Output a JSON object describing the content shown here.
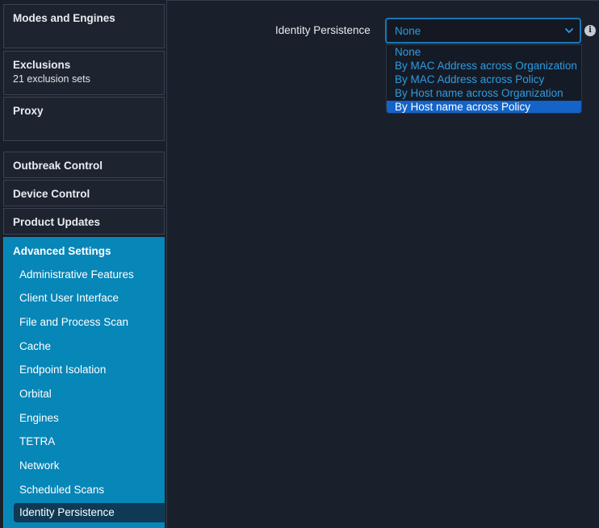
{
  "sidebar": {
    "modes": {
      "title": "Modes and Engines"
    },
    "exclusions": {
      "title": "Exclusions",
      "subtitle": "21 exclusion sets"
    },
    "proxy": {
      "title": "Proxy"
    },
    "outbreak": {
      "title": "Outbreak Control"
    },
    "device": {
      "title": "Device Control"
    },
    "updates": {
      "title": "Product Updates"
    },
    "advanced": {
      "title": "Advanced Settings",
      "items": [
        {
          "label": "Administrative Features"
        },
        {
          "label": "Client User Interface"
        },
        {
          "label": "File and Process Scan"
        },
        {
          "label": "Cache"
        },
        {
          "label": "Endpoint Isolation"
        },
        {
          "label": "Orbital"
        },
        {
          "label": "Engines"
        },
        {
          "label": "TETRA"
        },
        {
          "label": "Network"
        },
        {
          "label": "Scheduled Scans"
        },
        {
          "label": "Identity Persistence"
        }
      ],
      "active_index": 10
    }
  },
  "main": {
    "field_label": "Identity Persistence",
    "select_value": "None",
    "options": [
      "None",
      "By MAC Address across Organization",
      "By MAC Address across Policy",
      "By Host name across Organization",
      "By Host name across Policy"
    ],
    "highlighted_option_index": 4
  },
  "colors": {
    "background": "#1a202b",
    "accent": "#0786b8",
    "link_blue": "#2f9be0",
    "selected_option": "#1463c8"
  },
  "icons": {
    "select_chevron": "chevron-down-icon",
    "info": "info-icon"
  }
}
